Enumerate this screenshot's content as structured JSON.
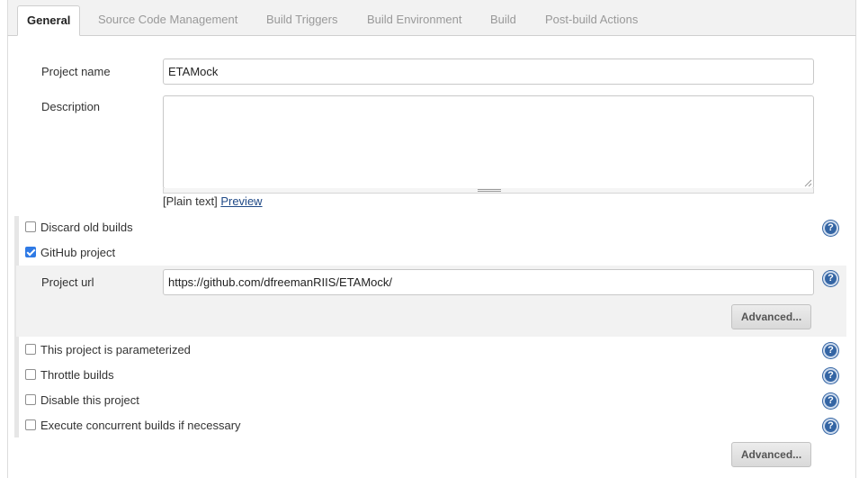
{
  "tabs": [
    {
      "label": "General",
      "active": true
    },
    {
      "label": "Source Code Management",
      "active": false
    },
    {
      "label": "Build Triggers",
      "active": false
    },
    {
      "label": "Build Environment",
      "active": false
    },
    {
      "label": "Build",
      "active": false
    },
    {
      "label": "Post-build Actions",
      "active": false
    }
  ],
  "project_name": {
    "label": "Project name",
    "value": "ETAMock"
  },
  "description": {
    "label": "Description",
    "value": "",
    "format_text": "[Plain text]",
    "preview_link": "Preview"
  },
  "options": [
    {
      "label": "Discard old builds",
      "checked": false,
      "help_icon": "question-icon"
    },
    {
      "label": "GitHub project",
      "checked": true
    },
    {
      "label": "This project is parameterized",
      "checked": false,
      "help_icon": "question-icon"
    },
    {
      "label": "Throttle builds",
      "checked": false,
      "help_icon": "question-icon"
    },
    {
      "label": "Disable this project",
      "checked": false,
      "help_icon": "question-icon"
    },
    {
      "label": "Execute concurrent builds if necessary",
      "checked": false,
      "help_icon": "question-icon"
    }
  ],
  "github": {
    "url_label": "Project url",
    "url_value": "https://github.com/dfreemanRIIS/ETAMock/",
    "advanced_label": "Advanced..."
  },
  "bottom": {
    "advanced_label": "Advanced..."
  },
  "help_glyph": "?",
  "colors": {
    "help_icon": "#3465a4",
    "checkbox_checked": "#2f7ae5",
    "link": "#204a87"
  }
}
